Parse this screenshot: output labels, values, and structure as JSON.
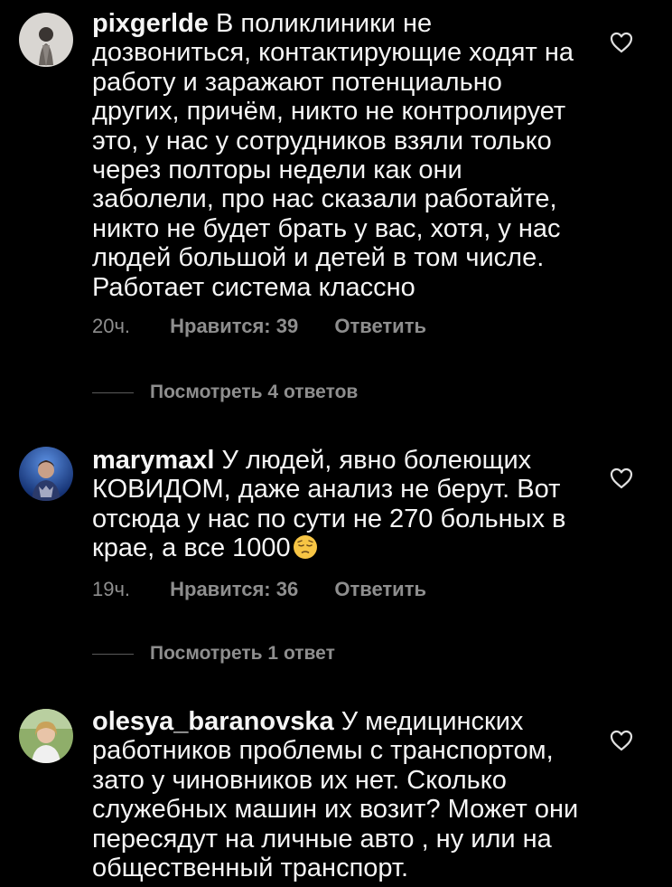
{
  "comments": [
    {
      "username": "pixgerlde",
      "text": "В поликлиники не дозвониться, контактирующие ходят на работу и заражают потенциально других, причём, никто не контролирует это, у нас у сотрудников взяли только через полторы недели как они заболели, про нас сказали работайте, никто не будет брать у вас, хотя, у нас людей большой и детей в том числе. Работает система классно",
      "time": "20ч.",
      "likes_label": "Нравится: 39",
      "reply_label": "Ответить",
      "view_replies_label": "Посмотреть 4 ответов",
      "avatar_icon": "avatar-light-icon",
      "heart_icon": "heart-outline-icon"
    },
    {
      "username": "marymaxl",
      "text": "У людей, явно болеющих КОВИДОМ, даже анализ не берут. Вот отсюда у нас по сути не 270 больных в крае, а все 1000",
      "emoji": "pensive-face-emoji",
      "time": "19ч.",
      "likes_label": "Нравится: 36",
      "reply_label": "Ответить",
      "view_replies_label": "Посмотреть 1 ответ",
      "avatar_icon": "avatar-blue-icon",
      "heart_icon": "heart-outline-icon"
    },
    {
      "username": "olesya_baranovska",
      "text": "У медицинских работников проблемы с транспортом, зато у чиновников их нет. Сколько служебных машин их возит? Может они пересядут на личные авто , ну или на общественный транспорт.",
      "avatar_icon": "avatar-outdoor-icon",
      "heart_icon": "heart-outline-icon"
    }
  ],
  "colors": {
    "background": "#000000",
    "text": "#f5f5f5",
    "secondary_text": "#8e8e8e",
    "divider": "#5a5a5a"
  }
}
